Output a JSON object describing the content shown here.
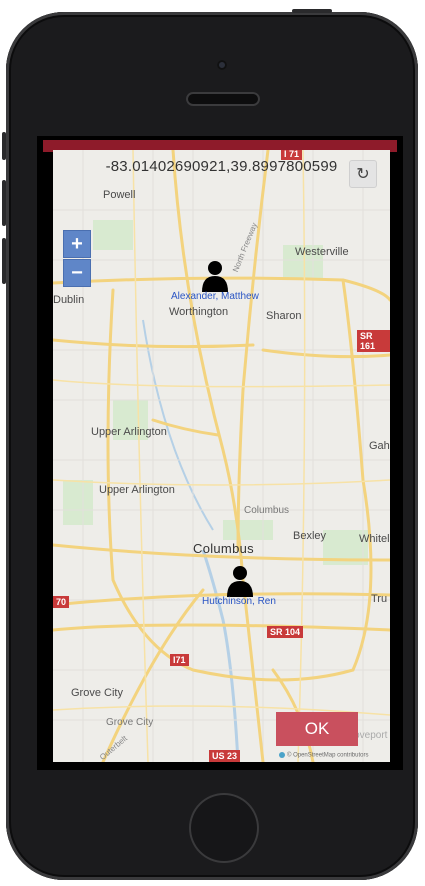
{
  "header": {
    "coordinates": "-83.01402690921,39.8997800599"
  },
  "controls": {
    "refresh_icon": "refresh-icon",
    "zoom_in_label": "+",
    "zoom_out_label": "−"
  },
  "places": {
    "powell": "Powell",
    "westerville": "Westerville",
    "dublin": "Dublin",
    "worthington": "Worthington",
    "sharon": "Sharon",
    "upper_arlington_1": "Upper Arlington",
    "upper_arlington_2": "Upper Arlington",
    "gah": "Gah",
    "columbus_small": "Columbus",
    "bexley": "Bexley",
    "columbus": "Columbus",
    "whitel": "Whitel",
    "tru": "Tru",
    "grove_city_1": "Grove City",
    "grove_city_2": "Grove City",
    "groveport": "Groveport"
  },
  "shields": {
    "sr161": "SR 161",
    "sr104": "SR 104",
    "i71_top": "I 71",
    "i71": "I71",
    "i70": "70",
    "us23": "US 23"
  },
  "road_labels": {
    "north_freeway": "North Freeway",
    "outerbelt": "Outerbelt"
  },
  "people": [
    {
      "name": "Alexander, Matthew"
    },
    {
      "name": "Hutchinson, Ren"
    }
  ],
  "ok_button": "OK",
  "attribution": "© OpenStreetMap contributors",
  "colors": {
    "frame_red": "#8e1b2a",
    "ok_button": "#c9505e",
    "zoom": "#5f86c8",
    "person_label": "#2a55c4"
  }
}
